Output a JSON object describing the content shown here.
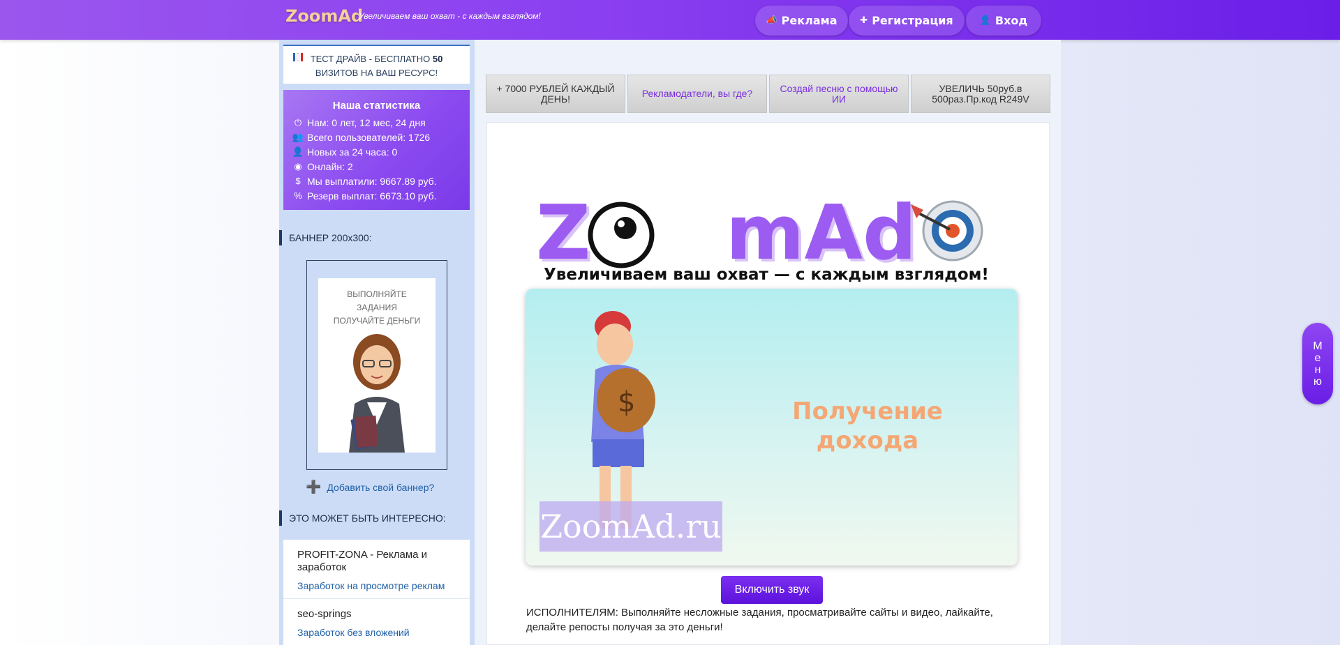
{
  "header": {
    "logo": "ZoomAd",
    "slogan": "Увеличиваем ваш охват - с каждым взглядом!",
    "nav": [
      {
        "label": "Реклама",
        "icon": "megaphone-icon"
      },
      {
        "label": "Регистрация",
        "icon": "plus-icon"
      },
      {
        "label": "Вход",
        "icon": "user-icon"
      }
    ]
  },
  "sidebar": {
    "test_drive": {
      "prefix": "ТЕСТ ДРАЙВ - БЕСПЛАТНО",
      "count": "50",
      "suffix": "ВИЗИТОВ НА ВАШ РЕСУРС!"
    },
    "stats": {
      "title": "Наша статистика",
      "rows": [
        {
          "icon": "power-icon",
          "text": "Нам: 0 лет, 12 мес, 24 дня"
        },
        {
          "icon": "users-icon",
          "text": "Всего пользователей: 1726"
        },
        {
          "icon": "user-plus-icon",
          "text": "Новых за 24 часа: 0"
        },
        {
          "icon": "user-circle-icon",
          "text": "Онлайн: 2"
        },
        {
          "icon": "dollar-icon",
          "text": "Мы выплатили: 9667.89 руб."
        },
        {
          "icon": "percent-icon",
          "text": "Резерв выплат: 6673.10 руб."
        }
      ]
    },
    "banner_section_title": "БАННЕР 200x300:",
    "banner_text": "ВЫПОЛНЯЙТЕ ЗАДАНИЯ ПОЛУЧАЙТЕ ДЕНЬГИ",
    "add_banner": "Добавить свой баннер?",
    "interest_title": "ЭТО МОЖЕТ БЫТЬ ИНТЕРЕСНО:",
    "interest_items": [
      {
        "title": "PROFIT-ZONA - Реклама и заработок",
        "subtitle": "Заработок на просмотре реклам"
      },
      {
        "title": "seo-springs",
        "subtitle": "Заработок без вложений"
      }
    ]
  },
  "ad_tiles": [
    {
      "text": "+ 7000 РУБЛЕЙ КАЖДЫЙ ДЕНЬ!",
      "color": "#333333"
    },
    {
      "text": "Рекламодатели, вы где?",
      "color": "#7a2ee0"
    },
    {
      "text": "Создай песню с помощью ИИ",
      "color": "#7a2ee0"
    },
    {
      "text": "УВЕЛИЧЬ 50руб.в 500раз.Пр.код R249V",
      "color": "#333333"
    }
  ],
  "hero": {
    "logo_left": "Z",
    "logo_right": "mAd",
    "tagline": "Увеличиваем ваш охват — с каждым взглядом!"
  },
  "video": {
    "caption": "Получение дохода",
    "watermark": "ZoomAd.ru"
  },
  "sound_button": "Включить звук",
  "performers_text": "ИСПОЛНИТЕЛЯМ: Выполняйте несложные задания, просматривайте сайты и видео, лайкайте, делайте репосты получая за это деньги!",
  "side_menu": [
    "М",
    "е",
    "н",
    "ю"
  ],
  "colors": {
    "brand_purple": "#8a3ff0",
    "logo_orange": "#f6cf9c",
    "link_blue": "#1f5fa8"
  }
}
